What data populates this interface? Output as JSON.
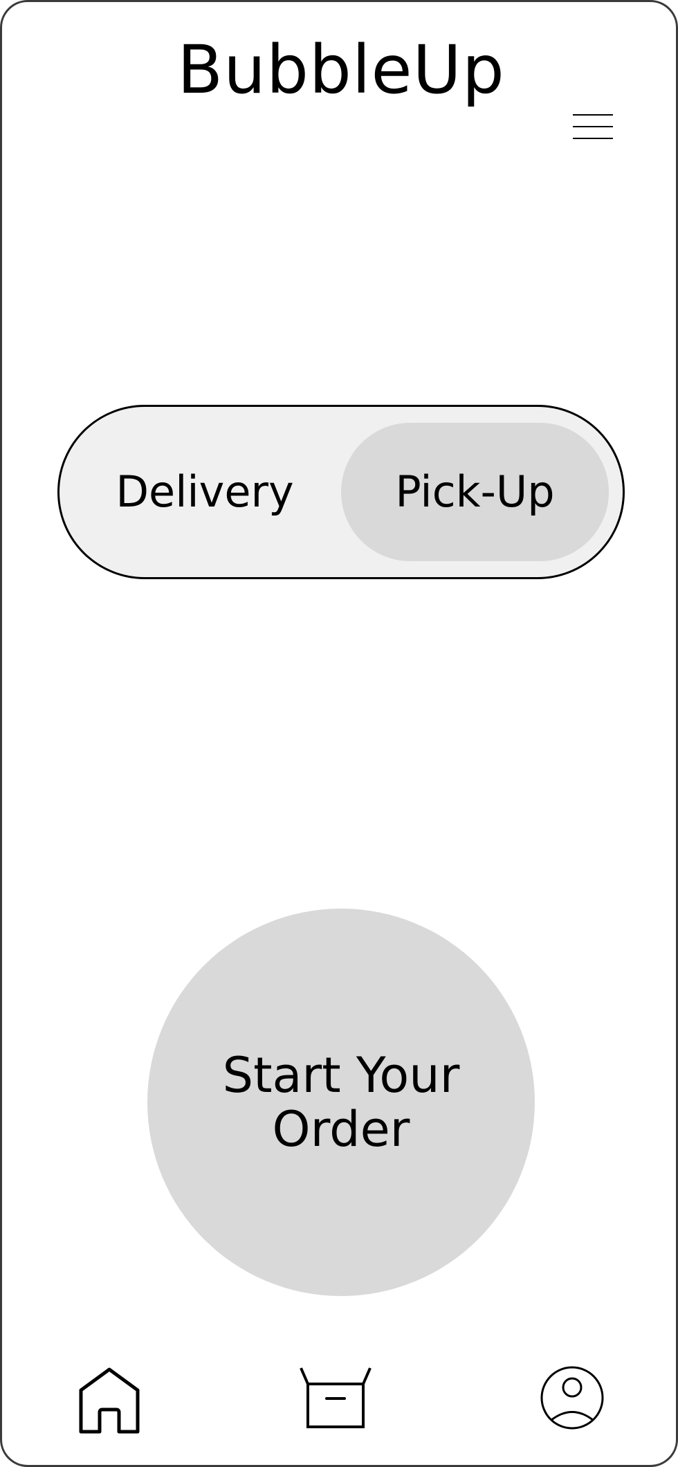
{
  "header": {
    "title": "BubbleUp",
    "menu_icon": "hamburger-menu-icon"
  },
  "order_mode_toggle": {
    "options": [
      {
        "label": "Delivery",
        "selected": false
      },
      {
        "label": "Pick-Up",
        "selected": true
      }
    ]
  },
  "main": {
    "start_order_label": "Start Your Order"
  },
  "bottom_nav": {
    "items": [
      {
        "icon": "home-icon"
      },
      {
        "icon": "box-icon"
      },
      {
        "icon": "user-profile-icon"
      }
    ]
  },
  "colors": {
    "frame_border": "#3a3a3a",
    "toggle_background": "#f0f0f0",
    "selected_pill": "#d9d9d9",
    "start_button": "#d9d9d9",
    "text": "#000000"
  }
}
